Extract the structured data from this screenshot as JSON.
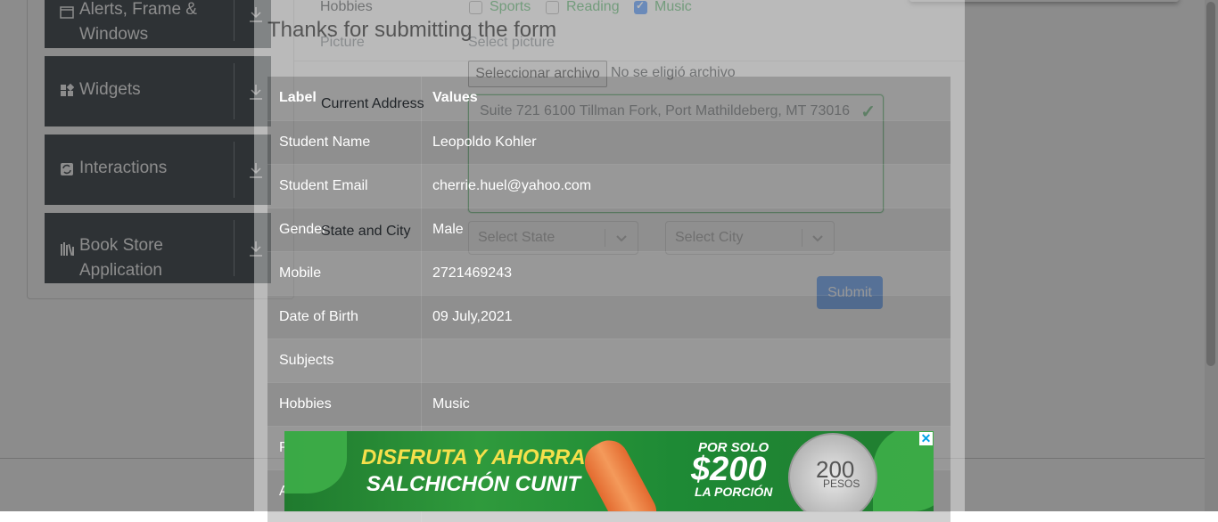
{
  "sidebar": {
    "groups": [
      {
        "label_line1": "Alerts, Frame &",
        "label_line2": "Windows",
        "icon": "window-icon"
      },
      {
        "label_line1": "Widgets",
        "label_line2": "",
        "icon": "widgets-icon"
      },
      {
        "label_line1": "Interactions",
        "label_line2": "",
        "icon": "interactions-icon"
      },
      {
        "label_line1": "Book Store",
        "label_line2": "Application",
        "icon": "books-icon"
      }
    ]
  },
  "form": {
    "hobbies_label": "Hobbies",
    "hobbies": [
      {
        "label": "Sports",
        "checked": false
      },
      {
        "label": "Reading",
        "checked": false
      },
      {
        "label": "Music",
        "checked": true
      }
    ],
    "picture_label": "Picture",
    "picture_hint": "Select picture",
    "file_button": "Seleccionar archivo",
    "file_status": "No se eligió archivo",
    "address_label": "Current Address",
    "address_value": "Suite 721 6100 Tillman Fork, Port Mathildeberg, MT 73016",
    "state_city_label": "State and City",
    "state_placeholder": "Select State",
    "city_placeholder": "Select City",
    "submit_label": "Submit"
  },
  "modal": {
    "title": "Thanks for submitting the form",
    "header": {
      "label": "Label",
      "value": "Values"
    },
    "rows": [
      {
        "label": "Student Name",
        "value": "Leopoldo Kohler"
      },
      {
        "label": "Student Email",
        "value": "cherrie.huel@yahoo.com"
      },
      {
        "label": "Gender",
        "value": "Male"
      },
      {
        "label": "Mobile",
        "value": "2721469243"
      },
      {
        "label": "Date of Birth",
        "value": "09 July,2021"
      },
      {
        "label": "Subjects",
        "value": ""
      },
      {
        "label": "Hobbies",
        "value": "Music"
      },
      {
        "label": "P",
        "value": ""
      },
      {
        "label": "A",
        "value": ""
      }
    ]
  },
  "ad": {
    "headline1": "DISFRUTA Y AHORRA",
    "headline2": "SALCHICHÓN CUNIT",
    "price_prefix": "POR SOLO",
    "price": "$200",
    "price_suffix": "LA PORCIÓN",
    "coin_value": "200",
    "coin_word": "PESOS",
    "close": "✕"
  }
}
